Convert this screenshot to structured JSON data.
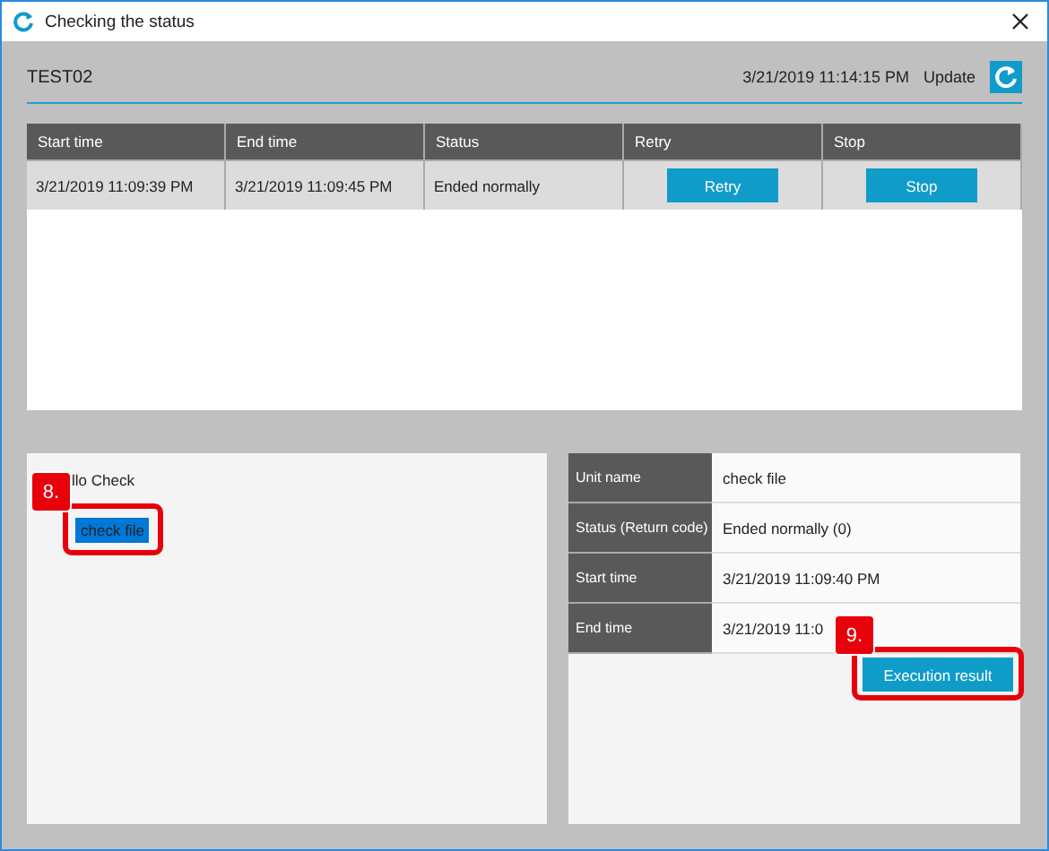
{
  "window": {
    "title": "Checking the status"
  },
  "header": {
    "job": "TEST02",
    "timestamp": "3/21/2019 11:14:15 PM",
    "update_label": "Update"
  },
  "table": {
    "columns": [
      "Start time",
      "End time",
      "Status",
      "Retry",
      "Stop"
    ],
    "rows": [
      {
        "start": "3/21/2019 11:09:39 PM",
        "end": "3/21/2019 11:09:45 PM",
        "status": "Ended normally",
        "retry": "Retry",
        "stop": "Stop"
      }
    ]
  },
  "tree": {
    "items": [
      {
        "label": "llo Check",
        "selected": false,
        "children": [
          {
            "label": "check file",
            "selected": true
          }
        ]
      }
    ]
  },
  "details": [
    {
      "label": "Unit name",
      "value": "check file"
    },
    {
      "label": "Status (Return code)",
      "value": "Ended normally (0)"
    },
    {
      "label": "Start time",
      "value": "3/21/2019 11:09:40 PM"
    },
    {
      "label": "End time",
      "value": "3/21/2019 11:0"
    }
  ],
  "result_button": "Execution result",
  "callouts": [
    {
      "label": "8."
    },
    {
      "label": "9."
    }
  ]
}
